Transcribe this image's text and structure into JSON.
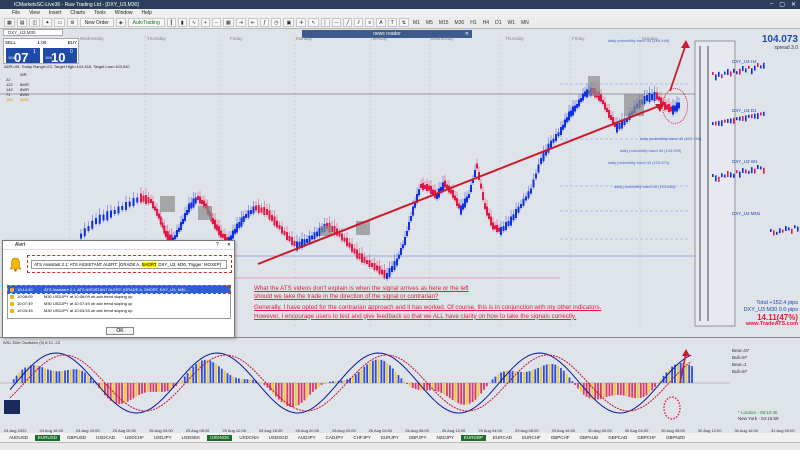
{
  "window": {
    "title": "ICMarketsSC-Live36 - Raw Trading Ltd - [DXY_U3,M30]",
    "controls": [
      "–",
      "▢",
      "✕"
    ]
  },
  "menu": [
    "File",
    "View",
    "Insert",
    "Charts",
    "Tools",
    "Window",
    "Help"
  ],
  "toolbar": {
    "new_order": "New Order",
    "autotrading": "AutoTrading",
    "timeframes": [
      "M1",
      "M5",
      "M15",
      "M30",
      "H1",
      "H4",
      "D1",
      "W1",
      "MN"
    ]
  },
  "chart_tab": "DXY_U3,M30",
  "one_click": {
    "sell_label": "SELL",
    "buy_label": "BUY",
    "lot": "1.00",
    "sell_small": "104",
    "sell_big": "07",
    "sell_sup": "1",
    "buy_small": "104",
    "buy_big": "10",
    "buy_sup": "0"
  },
  "info_line": "ADR=49, Today Range=23, Target High=104.516, Target Low=103.540",
  "wr_table": {
    "header": "WR",
    "rows": [
      [
        "22",
        ""
      ],
      [
        "122",
        "8WR"
      ],
      [
        "142",
        "8WR"
      ],
      [
        "71",
        "8WR"
      ],
      [
        "185",
        "8WR"
      ]
    ]
  },
  "news_reader": "news reader",
  "day_labels": [
    "Wednesday",
    "Thursday",
    "Friday",
    "Monday",
    "Tuesday",
    "Wednesday",
    "Thursday",
    "Friday",
    "Monday"
  ],
  "price": {
    "value": "104.073",
    "spread": "spread 3.0"
  },
  "mini_charts": [
    "DXY_U3 H4",
    "DXY_U3 D1",
    "DXY_U3 W1",
    "DXY_U3 MN1"
  ],
  "probability_labels": [
    "daily probability band 40 (104.449)",
    "daily probability band 40 (104.166)",
    "daily probability band 40 (103.909)",
    "daily probability band 40 (103.871)",
    "daily probability band 40 (103.684)"
  ],
  "annotation": {
    "line1": "What the ATS videos don't explain is when the signal arrives as here or the left",
    "line2": "should we take the trade in the direction of the signal or contrarian?",
    "line3": "Generally, I have opted for the contrarian approach and it has worked. Of course, this is in conjunction with my other indicators.",
    "line4": "However, I encourage users to test and give feedback so that we ALL have clarity on how to take the signals correctly."
  },
  "stats": {
    "total": "Total +152.4 pips",
    "pair": "DXY_U3    M30 0.0 pips",
    "percent": "14.11(47%)",
    "website": "www.TradeATS.com"
  },
  "alert": {
    "title": "Alert",
    "message_prefix": "ATS Assistant 2.1: ATS ASSISTANT ALERT: [GRADE A, ",
    "message_highlight": "SHORT",
    "message_suffix": ", DXY_U3, M30, Trigger: MOXEP]",
    "rows": [
      {
        "time": "10:14:49",
        "text": "ATS Assistant 2.1: ATS ASSISTANT ALERT: [GRADE A, SHORT, DXY_U3, M30...",
        "selected": true
      },
      {
        "time": "10:08:09",
        "text": "M30 USDJPY at 10:08:09 ob adx trend sloping up",
        "selected": false
      },
      {
        "time": "10:07:49",
        "text": "M30 USDJPY at 10:07:49 ob adx trend sloping up",
        "selected": false
      },
      {
        "time": "10:03:33",
        "text": "M30 USDJPY at 10:03:33 ob adx trend sloping up",
        "selected": false
      }
    ],
    "ok": "OK"
  },
  "oscillator": {
    "label": "WSL Elite Oscillator (5) 8 21 -23",
    "side_labels": [
      "Bear=97",
      "Bull=97",
      "Bear=1",
      "Bull=97"
    ],
    "session_labels": [
      "* London - 08:10:46",
      "New York - 04:15:59"
    ]
  },
  "time_axis": [
    "24 Aug 2022",
    "24 Aug 16:00",
    "24 Aug 20:00",
    "25 Aug 00:00",
    "25 Aug 04:00",
    "25 Aug 08:00",
    "25 Aug 12:00",
    "25 Aug 16:00",
    "25 Aug 20:00",
    "26 Aug 00:00",
    "26 Aug 04:00",
    "26 Aug 08:00",
    "26 Aug 12:00",
    "29 Aug 04:00",
    "29 Aug 08:00",
    "29 Aug 16:00",
    "30 Aug 00:00",
    "30 Aug 04:00",
    "30 Aug 08:00",
    "30 Aug 12:00",
    "30 Aug 16:00",
    "31 Aug 00:00"
  ],
  "symbols": [
    {
      "name": "AUDUSD",
      "green": false
    },
    {
      "name": "EURUSD",
      "green": true
    },
    {
      "name": "GBPUSD",
      "green": false
    },
    {
      "name": "USDCAD",
      "green": false
    },
    {
      "name": "USDCHF",
      "green": false
    },
    {
      "name": "USDJPY",
      "green": false
    },
    {
      "name": "USDSEK",
      "green": false
    },
    {
      "name": "USDNOK",
      "green": true
    },
    {
      "name": "USDCNH",
      "green": false
    },
    {
      "name": "USDSGD",
      "green": false
    },
    {
      "name": "AUDJPY",
      "green": false
    },
    {
      "name": "CADJPY",
      "green": false
    },
    {
      "name": "CHFJPY",
      "green": false
    },
    {
      "name": "EURJPY",
      "green": false
    },
    {
      "name": "GBPJPY",
      "green": false
    },
    {
      "name": "NZDJPY",
      "green": false
    },
    {
      "name": "EURGBP",
      "green": true
    },
    {
      "name": "EURCAD",
      "green": false
    },
    {
      "name": "EURCHF",
      "green": false
    },
    {
      "name": "GBPCHF",
      "green": false
    },
    {
      "name": "GBPAUD",
      "green": false
    },
    {
      "name": "GBPCAD",
      "green": false
    },
    {
      "name": "GBPCHF",
      "green": false
    },
    {
      "name": "GBPNZD",
      "green": false
    }
  ],
  "colors": {
    "bull": "#1030e0",
    "bear": "#e01848",
    "accent_red": "#e8183a",
    "price_blue": "#1f4aa8"
  }
}
